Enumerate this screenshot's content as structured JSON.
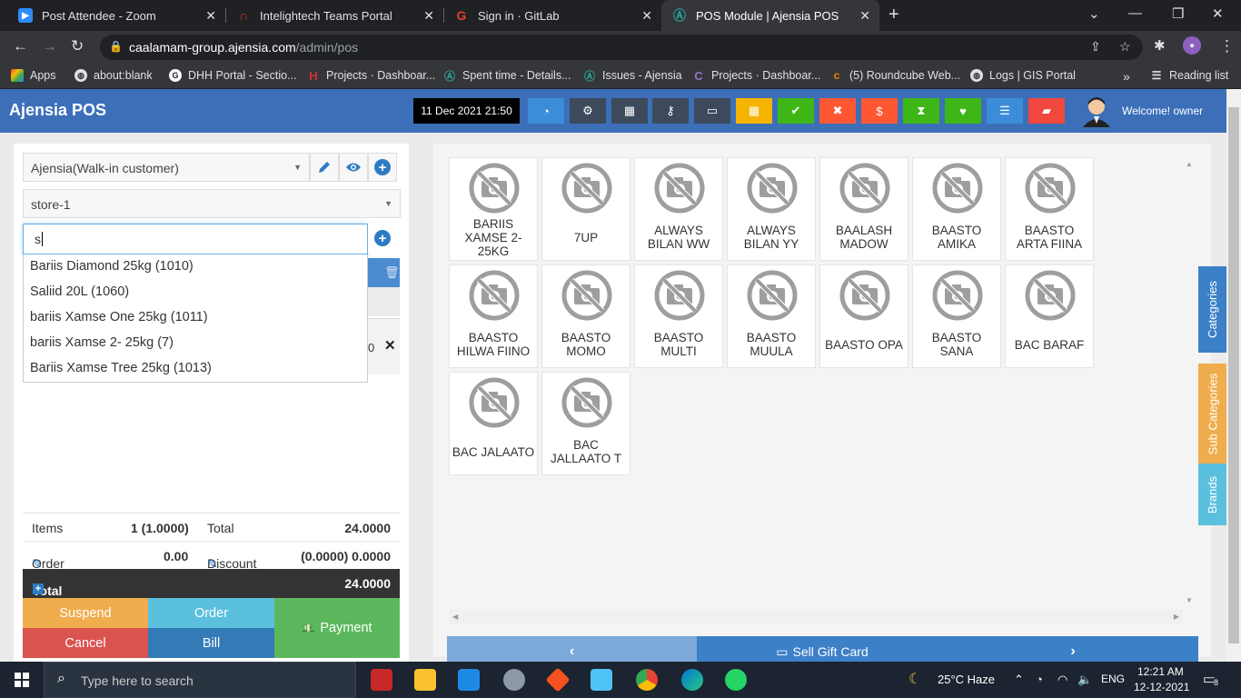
{
  "browser": {
    "tabs": [
      {
        "title": "Post Attendee - Zoom",
        "color": "#2d8cff"
      },
      {
        "title": "Intelightech Teams Portal",
        "color": "#d32f2f"
      },
      {
        "title": "Sign in · GitLab",
        "color": "#e24329"
      },
      {
        "title": "POS Module | Ajensia POS",
        "color": "#26a69a"
      }
    ],
    "url_host": "caalamam-group.ajensia.com",
    "url_path": "/admin/pos",
    "bookmarks": [
      "Apps",
      "about:blank",
      "DHH Portal - Sectio...",
      "Projects · Dashboar...",
      "Spent time - Details...",
      "Issues - Ajensia",
      "Projects · Dashboar...",
      "(5) Roundcube Web...",
      "Logs | GIS Portal"
    ],
    "reading_list": "Reading list"
  },
  "header": {
    "brand": "Ajensia POS",
    "datetime": "11 Dec 2021 21:50",
    "welcome": "Welcome! owner",
    "buttons": [
      {
        "icon": "dashboard-icon",
        "color": "#3c8dd9"
      },
      {
        "icon": "settings-icon",
        "color": "#3d4a5c"
      },
      {
        "icon": "calculator-icon",
        "color": "#3d4a5c"
      },
      {
        "icon": "key-icon",
        "color": "#3d4a5c"
      },
      {
        "icon": "laptop-icon",
        "color": "#3d4a5c"
      },
      {
        "icon": "grid-icon",
        "color": "#f5b400"
      },
      {
        "icon": "check-icon",
        "color": "#3fb618"
      },
      {
        "icon": "close-circle-icon",
        "color": "#ff5733"
      },
      {
        "icon": "dollar-icon",
        "color": "#ff5733"
      },
      {
        "icon": "hourglass-icon",
        "color": "#3fb618"
      },
      {
        "icon": "heart-icon",
        "color": "#3fb618"
      },
      {
        "icon": "list-icon",
        "color": "#3c8dd9"
      },
      {
        "icon": "eraser-icon",
        "color": "#f0483e"
      }
    ]
  },
  "order": {
    "customer": "Ajensia(Walk-in customer)",
    "store": "store-1",
    "search_value": "s",
    "suggestions": [
      "Bariis Diamond 25kg (1010)",
      "Saliid 20L (1060)",
      "bariis Xamse One 25kg (1011)",
      "bariis Xamse 2- 25kg (7)",
      "Bariis Xamse Tree 25kg (1013)"
    ],
    "hidden_qty": "0",
    "totals": {
      "items_label": "Items",
      "items_value": "1 (1.0000)",
      "total_label": "Total",
      "total_value": "24.0000",
      "tax_label": "Order Tax",
      "tax_value": "0.00",
      "discount_label": "Discount",
      "discount_value": "(0.0000) 0.0000",
      "payable_label": "Total Payable",
      "payable_value": "24.0000"
    },
    "actions": {
      "suspend": "Suspend",
      "order": "Order",
      "payment": "Payment",
      "cancel": "Cancel",
      "bill": "Bill"
    }
  },
  "products": [
    "BARIIS XAMSE 2- 25KG",
    "7UP",
    "ALWAYS BILAN WW",
    "ALWAYS BILAN YY",
    "BAALASH MADOW",
    "BAASTO AMIKA",
    "BAASTO ARTA FIINA",
    "BAASTO HILWA FIINO",
    "BAASTO MOMO",
    "BAASTO MULTI",
    "BAASTO MUULA",
    "BAASTO OPA",
    "BAASTO SANA",
    "BAC BARAF",
    "BAC JALAATO",
    "BAC JALLAATO T"
  ],
  "side_tabs": {
    "categories": "Categories",
    "sub_categories": "Sub Categories",
    "brands": "Brands"
  },
  "bottom_nav": {
    "gift": "Sell Gift Card"
  },
  "taskbar": {
    "search_placeholder": "Type here to search",
    "weather": "25°C  Haze",
    "lang": "ENG",
    "time": "12:21 AM",
    "date": "12-12-2021",
    "notifications": "8"
  }
}
